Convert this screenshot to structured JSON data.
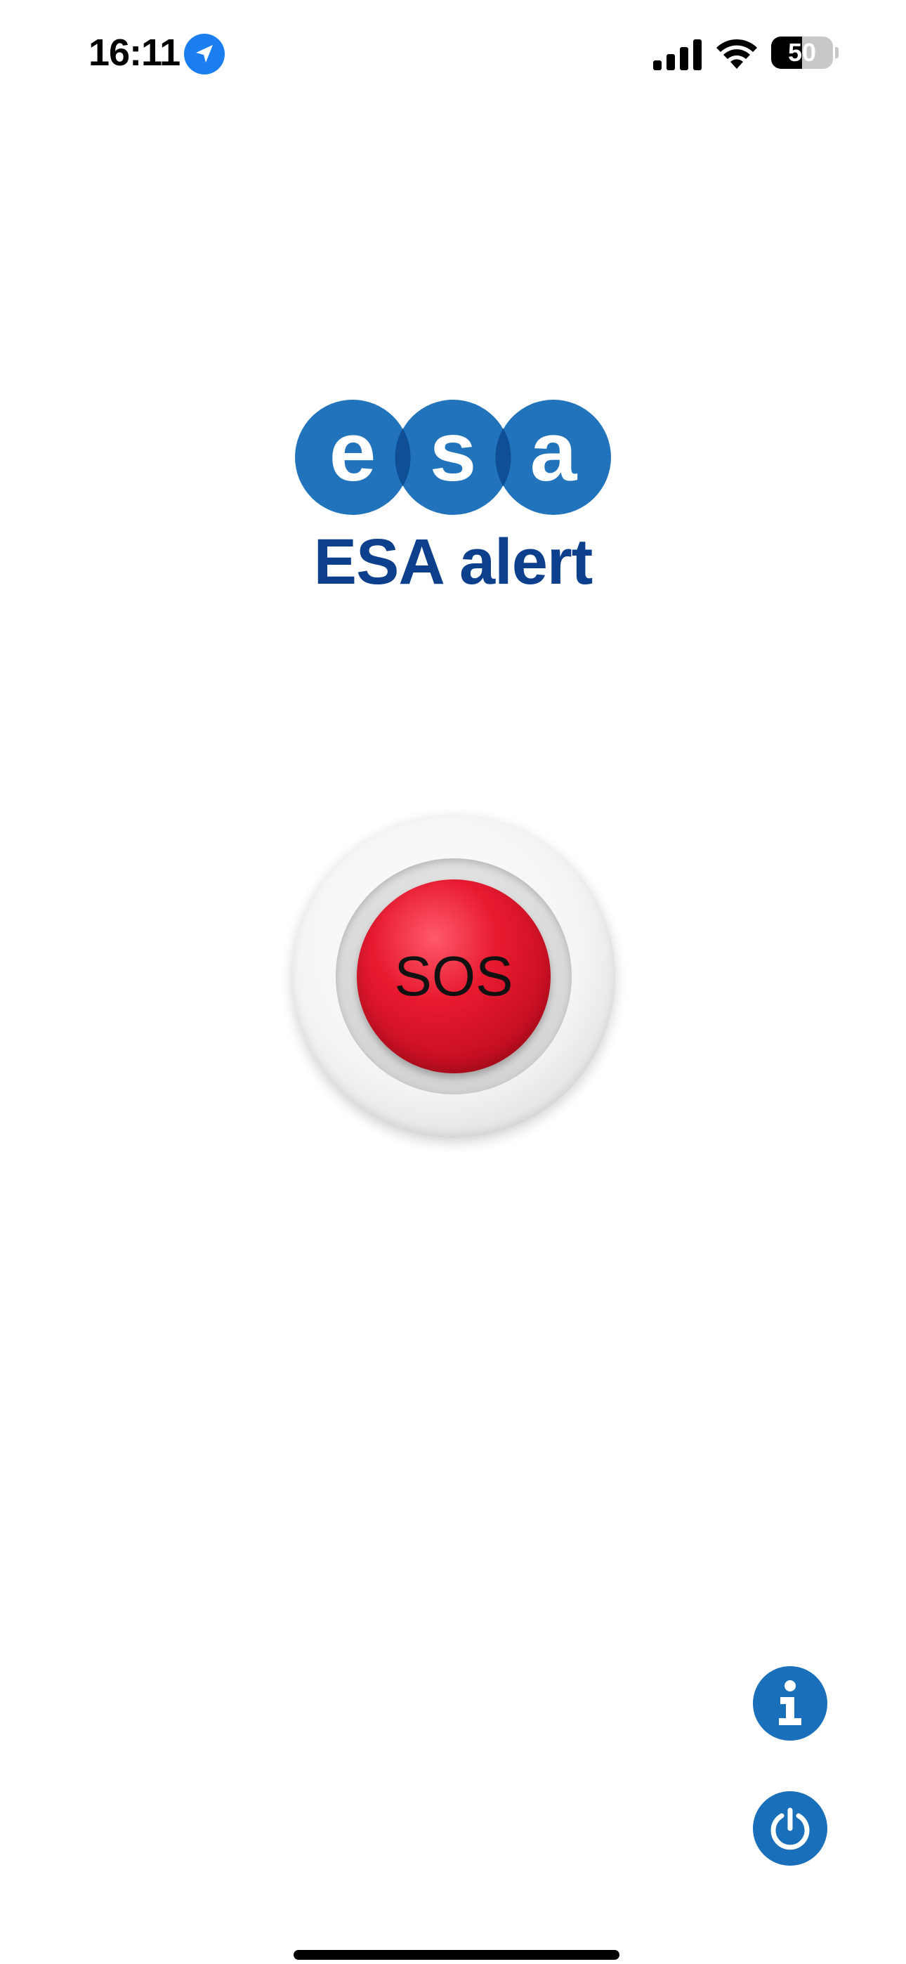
{
  "status_bar": {
    "time": "16:11",
    "battery_level": "50",
    "battery_fraction": 0.5,
    "icons": [
      "location-arrow-icon",
      "cellular-signal-icon",
      "wifi-icon",
      "battery-icon"
    ]
  },
  "brand": {
    "logo_letters": [
      "e",
      "s",
      "a"
    ],
    "title": "ESA alert",
    "colors": {
      "logo_blue": "#1a6fba",
      "logo_overlap": "#0e4f98",
      "title_blue": "#0c3f8c"
    }
  },
  "sos": {
    "label": "SOS",
    "color": "#d8152a"
  },
  "actions": [
    {
      "name": "info-button",
      "icon": "info-icon"
    },
    {
      "name": "power-button",
      "icon": "power-icon"
    }
  ],
  "accent_color": "#1a6fba",
  "location_color": "#1a7ef0"
}
